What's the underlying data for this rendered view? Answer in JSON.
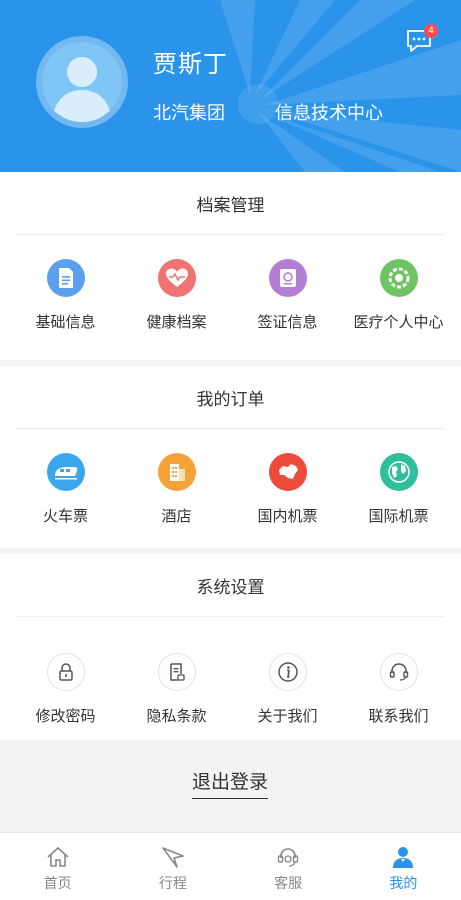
{
  "header": {
    "user_name": "贾斯丁",
    "company": "北汽集团",
    "department": "信息技术中心",
    "message_badge": "4",
    "bg_color": "#2a93ea"
  },
  "sections": {
    "archive": {
      "title": "档案管理",
      "items": [
        {
          "label": "基础信息",
          "icon": "document-icon",
          "color": "#5aa0ee"
        },
        {
          "label": "健康档案",
          "icon": "heart-icon",
          "color": "#f07373"
        },
        {
          "label": "签证信息",
          "icon": "passport-icon",
          "color": "#b57ed6"
        },
        {
          "label": "医疗个人中心",
          "icon": "medical-icon",
          "color": "#6ec462"
        }
      ]
    },
    "orders": {
      "title": "我的订单",
      "items": [
        {
          "label": "火车票",
          "icon": "train-icon",
          "color": "#39a6ee"
        },
        {
          "label": "酒店",
          "icon": "hotel-icon",
          "color": "#f5a238"
        },
        {
          "label": "国内机票",
          "icon": "china-map-icon",
          "color": "#ee4a3a"
        },
        {
          "label": "国际机票",
          "icon": "globe-icon",
          "color": "#2fbf9a"
        }
      ]
    },
    "settings": {
      "title": "系统设置",
      "items": [
        {
          "label": "修改密码",
          "icon": "lock-icon"
        },
        {
          "label": "隐私条款",
          "icon": "privacy-doc-icon"
        },
        {
          "label": "关于我们",
          "icon": "info-icon"
        },
        {
          "label": "联系我们",
          "icon": "headset-icon"
        }
      ]
    }
  },
  "logout": {
    "label": "退出登录"
  },
  "tabbar": {
    "active_color": "#2a93ea",
    "tabs": [
      {
        "label": "首页",
        "icon": "home-icon",
        "active": false
      },
      {
        "label": "行程",
        "icon": "paper-plane-icon",
        "active": false
      },
      {
        "label": "客服",
        "icon": "customer-service-icon",
        "active": false
      },
      {
        "label": "我的",
        "icon": "user-icon",
        "active": true
      }
    ]
  }
}
